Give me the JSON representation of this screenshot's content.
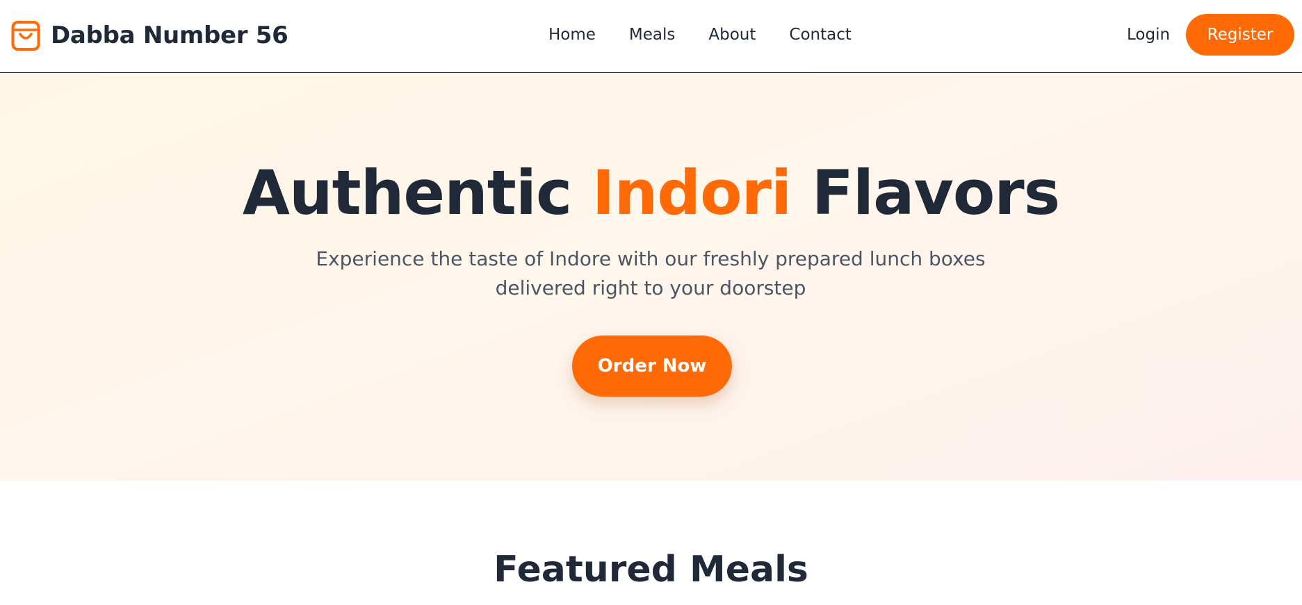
{
  "brand": {
    "name": "Dabba Number 56",
    "icon": "shopping-bag-icon"
  },
  "nav": {
    "items": [
      {
        "label": "Home"
      },
      {
        "label": "Meals"
      },
      {
        "label": "About"
      },
      {
        "label": "Contact"
      }
    ],
    "login_label": "Login",
    "register_label": "Register"
  },
  "hero": {
    "title_part1": "Authentic ",
    "title_accent": "Indori",
    "title_part2": " Flavors",
    "subtitle_line1": "Experience the taste of Indore with our freshly prepared lunch boxes",
    "subtitle_line2": "delivered right to your doorstep",
    "cta_label": "Order Now"
  },
  "featured": {
    "title": "Featured Meals"
  },
  "colors": {
    "accent": "#ff6a06",
    "text_dark": "#1f2937",
    "text_muted": "#4b5563",
    "hero_bg_start": "#fff7e6",
    "hero_bg_end": "#fdf0ee"
  }
}
